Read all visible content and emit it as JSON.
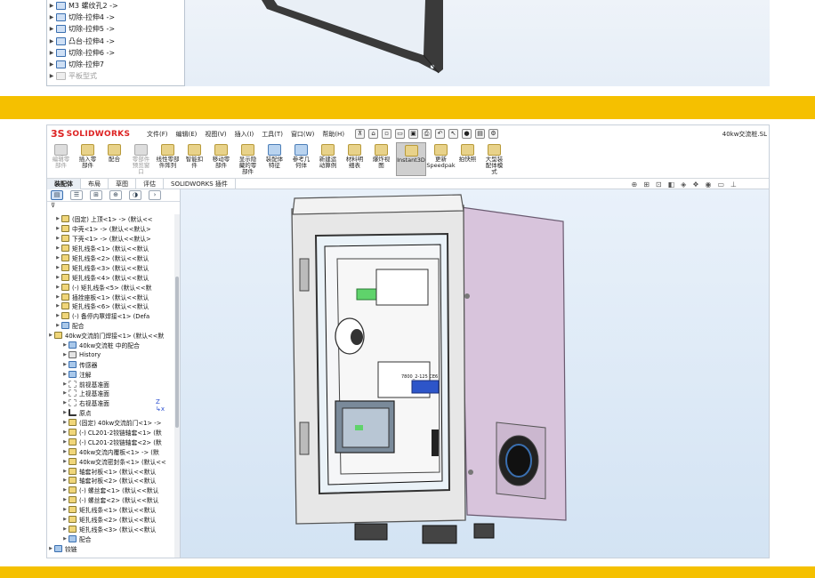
{
  "top_tree": {
    "items": [
      {
        "label": "M3 螺纹孔2 ->",
        "dim": false
      },
      {
        "label": "切除-拉伸4 ->",
        "dim": false
      },
      {
        "label": "切除-拉伸5 ->",
        "dim": false
      },
      {
        "label": "凸台-拉伸4 ->",
        "dim": false
      },
      {
        "label": "切除-拉伸6 ->",
        "dim": false
      },
      {
        "label": "切除-拉伸7",
        "dim": false
      },
      {
        "label": "平板型式",
        "dim": true
      }
    ]
  },
  "app": {
    "logo_prefix": "3S",
    "logo_text": "SOLIDWORKS",
    "document_title": "40kw交流桩.SL"
  },
  "menu": [
    "文件(F)",
    "编辑(E)",
    "视图(V)",
    "插入(I)",
    "工具(T)",
    "窗口(W)",
    "帮助(H)"
  ],
  "ribbon": [
    {
      "label": "编辑零\n部件",
      "style": "grey"
    },
    {
      "label": "插入零\n部件",
      "style": "normal"
    },
    {
      "label": "配合",
      "style": "normal"
    },
    {
      "label": "零部件\n预览窗\n口",
      "style": "grey"
    },
    {
      "label": "线性零部\n件阵列",
      "style": "normal"
    },
    {
      "label": "智能扣\n件",
      "style": "normal"
    },
    {
      "label": "移动零\n部件",
      "style": "normal"
    },
    {
      "label": "显示隐\n藏的零\n部件",
      "style": "normal"
    },
    {
      "label": "装配体\n特征",
      "style": "blue"
    },
    {
      "label": "参考几\n何体",
      "style": "blue"
    },
    {
      "label": "新建运\n动算例",
      "style": "normal"
    },
    {
      "label": "材料明\n细表",
      "style": "normal"
    },
    {
      "label": "爆炸视\n图",
      "style": "normal"
    },
    {
      "label": "Instant3D",
      "style": "active"
    },
    {
      "label": "更新\nSpeedpak",
      "style": "normal"
    },
    {
      "label": "拍快照",
      "style": "normal"
    },
    {
      "label": "大型装\n配体模\n式",
      "style": "normal"
    }
  ],
  "tabs": [
    {
      "label": "装配体",
      "active": true
    },
    {
      "label": "布局",
      "active": false
    },
    {
      "label": "草图",
      "active": false
    },
    {
      "label": "评估",
      "active": false
    },
    {
      "label": "SOLIDWORKS 插件",
      "active": false
    }
  ],
  "tree": [
    {
      "label": "(固定) 上顶<1> -> (默认<<",
      "icon": "part",
      "indent": 1
    },
    {
      "label": "中壳<1> -> (默认<<默认>",
      "icon": "part",
      "indent": 1
    },
    {
      "label": "下壳<1> -> (默认<<默认>",
      "icon": "part",
      "indent": 1
    },
    {
      "label": "矩扎线条<1> (默认<<默认",
      "icon": "part",
      "indent": 1
    },
    {
      "label": "矩扎线条<2> (默认<<默认",
      "icon": "part",
      "indent": 1
    },
    {
      "label": "矩扎线条<3> (默认<<默认",
      "icon": "part",
      "indent": 1
    },
    {
      "label": "矩扎线条<4> (默认<<默认",
      "icon": "part",
      "indent": 1
    },
    {
      "label": "(-) 矩扎线条<5> (默认<<默",
      "icon": "part",
      "indent": 1
    },
    {
      "label": "插拴座板<1> (默认<<默认",
      "icon": "part",
      "indent": 1
    },
    {
      "label": "矩扎线条<6> (默认<<默认",
      "icon": "part",
      "indent": 1
    },
    {
      "label": "(-) 备停内覃焊接<1> (Defa",
      "icon": "part",
      "indent": 1
    },
    {
      "label": "配合",
      "icon": "folder",
      "indent": 1
    },
    {
      "label": "40kw交流前门焊接<1> (默认<<默",
      "icon": "part",
      "indent": 0
    },
    {
      "label": "40kw交流桩 中的配合",
      "icon": "folder",
      "indent": 2
    },
    {
      "label": "History",
      "icon": "hist",
      "indent": 2
    },
    {
      "label": "传感器",
      "icon": "folder",
      "indent": 2
    },
    {
      "label": "注解",
      "icon": "folder",
      "indent": 2
    },
    {
      "label": "前视基准面",
      "icon": "plane",
      "indent": 2
    },
    {
      "label": "上视基准面",
      "icon": "plane",
      "indent": 2
    },
    {
      "label": "右视基准面",
      "icon": "plane",
      "indent": 2
    },
    {
      "label": "原点",
      "icon": "origin",
      "indent": 2
    },
    {
      "label": "(固定) 40kw交流前门<1> ->",
      "icon": "part",
      "indent": 2
    },
    {
      "label": "(-) CL201-2铰链轴套<1> (默",
      "icon": "part",
      "indent": 2
    },
    {
      "label": "(-) CL201-2铰链轴套<2> (默",
      "icon": "part",
      "indent": 2
    },
    {
      "label": "40kw交流内覆板<1> -> (默",
      "icon": "part",
      "indent": 2
    },
    {
      "label": "40kw交流密封条<1> (默认<<",
      "icon": "part",
      "indent": 2
    },
    {
      "label": "轴套衬板<1> (默认<<默认",
      "icon": "part",
      "indent": 2
    },
    {
      "label": "轴套衬板<2> (默认<<默认",
      "icon": "part",
      "indent": 2
    },
    {
      "label": "(-) 螺丝套<1> (默认<<默认",
      "icon": "part",
      "indent": 2
    },
    {
      "label": "(-) 螺丝套<2> (默认<<默认",
      "icon": "part",
      "indent": 2
    },
    {
      "label": "矩扎线条<1> (默认<<默认",
      "icon": "part",
      "indent": 2
    },
    {
      "label": "矩扎线条<2> (默认<<默认",
      "icon": "part",
      "indent": 2
    },
    {
      "label": "矩扎线条<3> (默认<<默认",
      "icon": "part",
      "indent": 2
    },
    {
      "label": "配合",
      "icon": "folder",
      "indent": 2
    },
    {
      "label": "铰链",
      "icon": "folder",
      "indent": 0
    }
  ],
  "model_labels": {
    "breaker_text": "7800_2-125 CE6",
    "plate_text": "5kk 49"
  },
  "colors": {
    "band": "#f5c000",
    "enclosure": "#d8c4dc",
    "glass": "#eaf2f8",
    "accent_green": "#5fd36b",
    "tag_blue": "#2d55c9"
  }
}
